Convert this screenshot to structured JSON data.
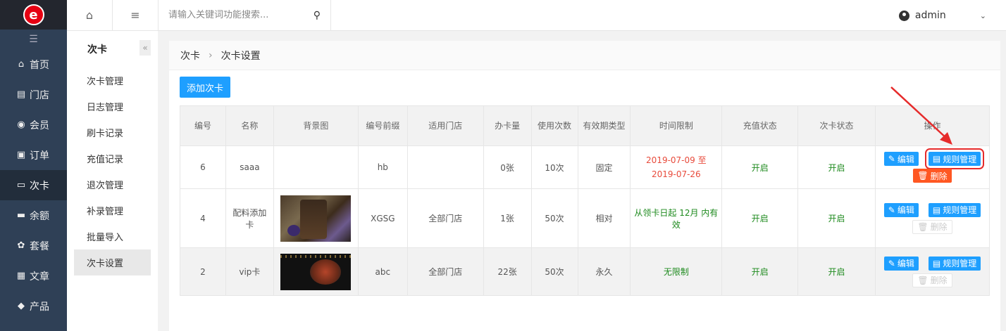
{
  "sidebar": {
    "logo_icon": "brand-logo-icon",
    "items": [
      {
        "icon": "home-icon",
        "glyph": "⌂",
        "label": "首页"
      },
      {
        "icon": "store-icon",
        "glyph": "▤",
        "label": "门店"
      },
      {
        "icon": "member-icon",
        "glyph": "◉",
        "label": "会员"
      },
      {
        "icon": "order-icon",
        "glyph": "▣",
        "label": "订单"
      },
      {
        "icon": "card-icon",
        "glyph": "▭",
        "label": "次卡"
      },
      {
        "icon": "balance-icon",
        "glyph": "▬",
        "label": "余额"
      },
      {
        "icon": "package-icon",
        "glyph": "✿",
        "label": "套餐"
      },
      {
        "icon": "article-icon",
        "glyph": "▦",
        "label": "文章"
      },
      {
        "icon": "product-icon",
        "glyph": "◆",
        "label": "产品"
      }
    ],
    "active_index": 4
  },
  "header": {
    "search_placeholder": "请输入关键词功能搜索...",
    "username": "admin"
  },
  "subnav": {
    "title": "次卡",
    "items": [
      "次卡管理",
      "日志管理",
      "刷卡记录",
      "充值记录",
      "退次管理",
      "补录管理",
      "批量导入",
      "次卡设置"
    ],
    "active_index": 7
  },
  "breadcrumb": {
    "root": "次卡",
    "current": "次卡设置"
  },
  "main": {
    "add_label": "添加次卡"
  },
  "table": {
    "headers": [
      "编号",
      "名称",
      "背景图",
      "编号前缀",
      "适用门店",
      "办卡量",
      "使用次数",
      "有效期类型",
      "时间限制",
      "充值状态",
      "次卡状态",
      "操作"
    ],
    "rows": [
      {
        "id": "6",
        "name": "saaa",
        "prefix": "hb",
        "store": "",
        "count": "0张",
        "uses": "10次",
        "validity": "固定",
        "time_limit": "2019-07-09 至 2019-07-26",
        "recharge": "开启",
        "status": "开启"
      },
      {
        "id": "4",
        "name": "配料添加卡",
        "prefix": "XGSG",
        "store": "全部门店",
        "count": "1张",
        "uses": "50次",
        "validity": "相对",
        "time_limit": "从领卡日起 12月 内有效",
        "recharge": "开启",
        "status": "开启"
      },
      {
        "id": "2",
        "name": "vip卡",
        "prefix": "abc",
        "store": "全部门店",
        "count": "22张",
        "uses": "50次",
        "validity": "永久",
        "time_limit": "无限制",
        "recharge": "开启",
        "status": "开启"
      }
    ],
    "edit_label": "编辑",
    "rules_label": "规则管理",
    "delete_label": "删除"
  }
}
